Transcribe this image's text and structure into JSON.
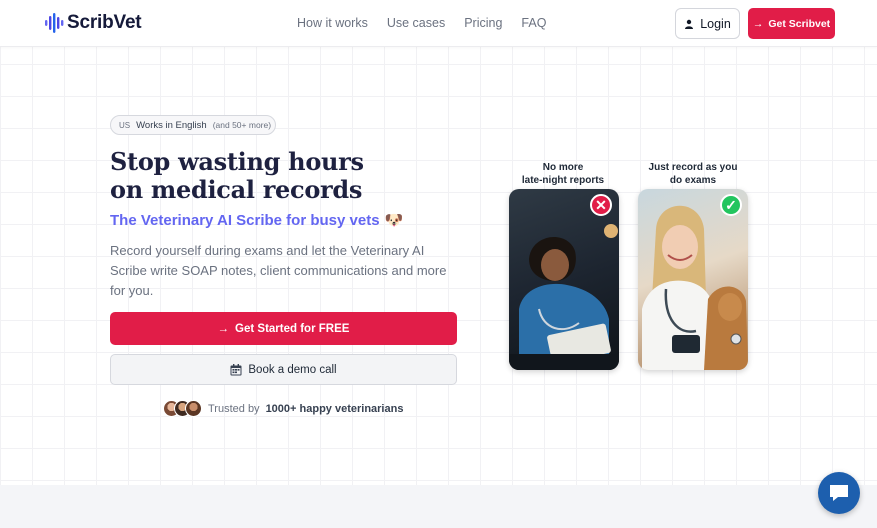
{
  "header": {
    "brand": "ScribVet",
    "nav": [
      "How it works",
      "Use cases",
      "Pricing",
      "FAQ"
    ],
    "login_label": "Login",
    "cta_label": "Get Scribvet"
  },
  "hero": {
    "lang_flag": "US",
    "lang_text": "Works in English",
    "lang_more": "(and 50+ more)",
    "headline_line1": "Stop wasting hours",
    "headline_line2": "on medical records",
    "subhead": "The Veterinary AI Scribe for busy vets",
    "subhead_emoji": "🐶",
    "description": "Record yourself during exams and let the Veterinary AI Scribe write SOAP notes, client communications and more for you.",
    "cta_primary": "Get Started for FREE",
    "cta_secondary": "Book a demo call",
    "trusted_prefix": "Trusted by",
    "trusted_bold": "1000+ happy veterinarians"
  },
  "cards": {
    "bad_label_1": "No more",
    "bad_label_2": "late-night reports",
    "good_label_1": "Just record as you",
    "good_label_2": "do exams"
  },
  "icons": {
    "logo": "soundwave-logo-icon",
    "login": "user-icon",
    "arrow": "arrow-right-icon",
    "calendar": "calendar-icon",
    "reject": "x-circle-icon",
    "approve": "check-circle-icon",
    "chat": "chat-bubble-icon"
  },
  "colors": {
    "primary": "#e11d48",
    "accent": "#6366f1",
    "heading": "#1e2140",
    "chat": "#1d5fae"
  }
}
